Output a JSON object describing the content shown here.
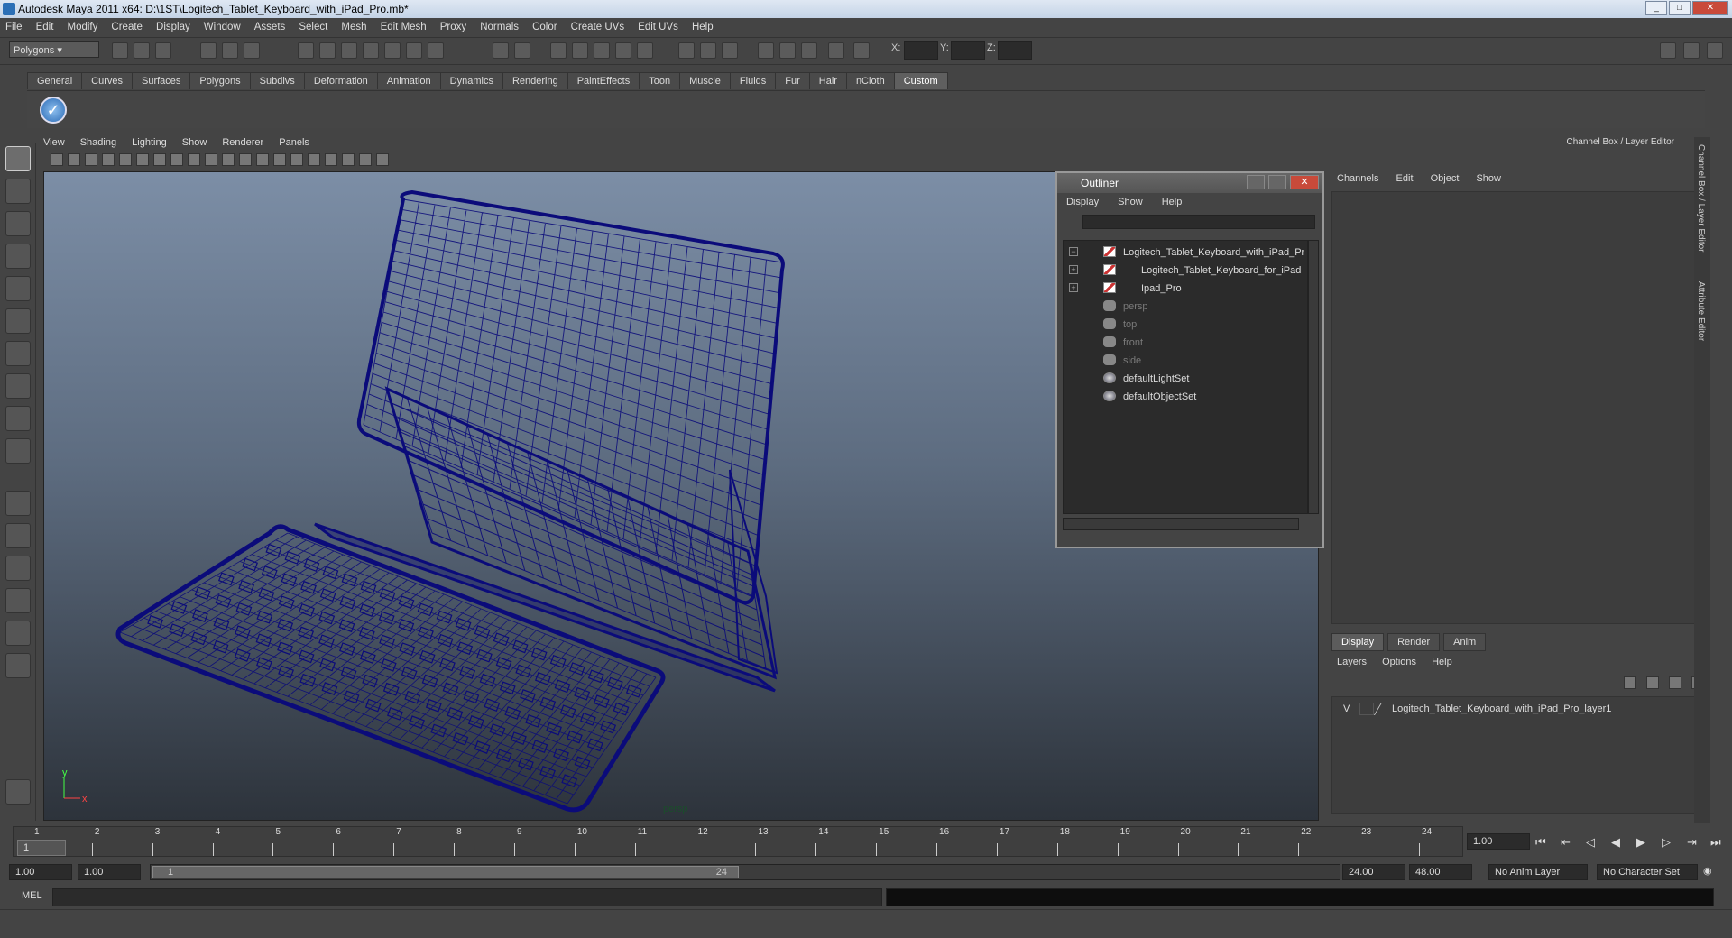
{
  "window": {
    "title": "Autodesk Maya 2011 x64: D:\\1ST\\Logitech_Tablet_Keyboard_with_iPad_Pro.mb*"
  },
  "menubar": [
    "File",
    "Edit",
    "Modify",
    "Create",
    "Display",
    "Window",
    "Assets",
    "Select",
    "Mesh",
    "Edit Mesh",
    "Proxy",
    "Normals",
    "Color",
    "Create UVs",
    "Edit UVs",
    "Help"
  ],
  "statusline": {
    "mode": "Polygons",
    "x_label": "X:",
    "y_label": "Y:",
    "z_label": "Z:"
  },
  "shelf": {
    "tabs": [
      "General",
      "Curves",
      "Surfaces",
      "Polygons",
      "Subdivs",
      "Deformation",
      "Animation",
      "Dynamics",
      "Rendering",
      "PaintEffects",
      "Toon",
      "Muscle",
      "Fluids",
      "Fur",
      "Hair",
      "nCloth",
      "Custom"
    ],
    "active_tab": "Custom"
  },
  "panel": {
    "menus": [
      "View",
      "Shading",
      "Lighting",
      "Show",
      "Renderer",
      "Panels"
    ],
    "camera_label": "persp"
  },
  "outliner": {
    "title": "Outliner",
    "menus": [
      "Display",
      "Show",
      "Help"
    ],
    "items": [
      {
        "label": "Logitech_Tablet_Keyboard_with_iPad_Pr",
        "type": "mesh",
        "expand": "−",
        "indent": 0
      },
      {
        "label": "Logitech_Tablet_Keyboard_for_iPad",
        "type": "mesh",
        "expand": "+",
        "indent": 1
      },
      {
        "label": "Ipad_Pro",
        "type": "mesh",
        "expand": "+",
        "indent": 1
      },
      {
        "label": "persp",
        "type": "camera",
        "expand": "",
        "indent": 0
      },
      {
        "label": "top",
        "type": "camera",
        "expand": "",
        "indent": 0
      },
      {
        "label": "front",
        "type": "camera",
        "expand": "",
        "indent": 0
      },
      {
        "label": "side",
        "type": "camera",
        "expand": "",
        "indent": 0
      },
      {
        "label": "defaultLightSet",
        "type": "set",
        "expand": "",
        "indent": 0
      },
      {
        "label": "defaultObjectSet",
        "type": "set",
        "expand": "",
        "indent": 0
      }
    ]
  },
  "channelbox": {
    "title": "Channel Box / Layer Editor",
    "menus": [
      "Channels",
      "Edit",
      "Object",
      "Show"
    ],
    "side_tabs": [
      "Channel Box / Layer Editor",
      "Attribute Editor"
    ],
    "layer_tabs": [
      "Display",
      "Render",
      "Anim"
    ],
    "active_layer_tab": "Display",
    "layer_menus": [
      "Layers",
      "Options",
      "Help"
    ],
    "layer": {
      "visibility": "V",
      "name": "Logitech_Tablet_Keyboard_with_iPad_Pro_layer1"
    }
  },
  "timeslider": {
    "frames": [
      "1",
      "2",
      "3",
      "4",
      "5",
      "6",
      "7",
      "8",
      "9",
      "10",
      "11",
      "12",
      "13",
      "14",
      "15",
      "16",
      "17",
      "18",
      "19",
      "20",
      "21",
      "22",
      "23",
      "24"
    ],
    "current_marker": "1",
    "current_frame": "1.00"
  },
  "rangeslider": {
    "start_time": "1.00",
    "playback_start": "1.00",
    "range_start_label": "1",
    "range_end_label": "24",
    "playback_end": "24.00",
    "end_time": "48.00",
    "anim_layer": "No Anim Layer",
    "character_set": "No Character Set"
  },
  "cmdline": {
    "label": "MEL"
  },
  "colors": {
    "wire": "#0b0b7a",
    "viewport_top": "#7c8ea6",
    "viewport_bottom": "#2d333b",
    "panel_bg": "#444444"
  }
}
